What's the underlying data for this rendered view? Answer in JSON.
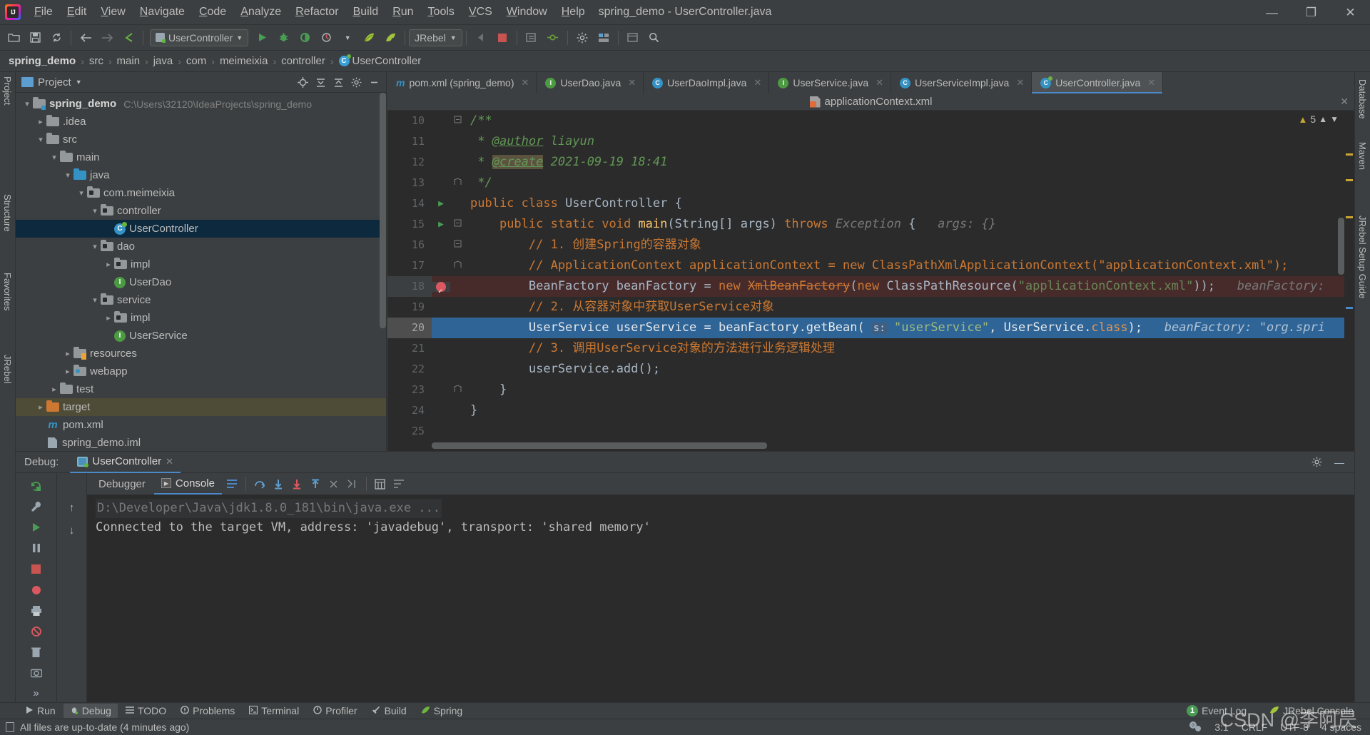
{
  "window": {
    "title": "spring_demo - UserController.java",
    "logo_icon": "intellij-idea-logo",
    "minimize": "—",
    "maximize": "❐",
    "close": "✕"
  },
  "menubar": {
    "items": [
      {
        "label": "File"
      },
      {
        "label": "Edit"
      },
      {
        "label": "View"
      },
      {
        "label": "Navigate"
      },
      {
        "label": "Code"
      },
      {
        "label": "Analyze"
      },
      {
        "label": "Refactor"
      },
      {
        "label": "Build"
      },
      {
        "label": "Run"
      },
      {
        "label": "Tools"
      },
      {
        "label": "VCS"
      },
      {
        "label": "Window"
      },
      {
        "label": "Help"
      }
    ]
  },
  "toolbar": {
    "run_config": "UserController",
    "jrebel_label": "JRebel",
    "icons": [
      "open-folder-icon",
      "save-all-icon",
      "sync-refresh-icon",
      "back-arrow-icon",
      "forward-arrow-icon",
      "pointer-icon",
      "run-icon",
      "debug-icon",
      "coverage-icon",
      "profile-icon",
      "jrebel-run-icon",
      "jrebel-debug-icon",
      "stop-icon",
      "build-icon",
      "hammer-icon",
      "layout-icon",
      "sync-icon",
      "settings-gear-icon",
      "structure-icon",
      "ui-designer-icon",
      "search-icon"
    ]
  },
  "breadcrumb": {
    "items": [
      "spring_demo",
      "src",
      "main",
      "java",
      "com",
      "meimeixia",
      "controller"
    ],
    "current": "UserController",
    "separator": "›"
  },
  "rails": {
    "left_top": "Project",
    "left_items": [
      "Structure",
      "Favorites",
      "JRebel"
    ],
    "right_items": [
      "Database",
      "Maven",
      "JRebel Setup Guide"
    ]
  },
  "project_panel": {
    "title": "Project",
    "header_icons": [
      "locate-icon",
      "collapse-all-icon",
      "expand-all-icon",
      "settings-gear-icon",
      "hide-icon"
    ],
    "tree": [
      {
        "depth": 0,
        "arrow": "open",
        "icon": "module-folder",
        "label": "spring_demo",
        "bold": true,
        "path": "C:\\Users\\32120\\IdeaProjects\\spring_demo",
        "selected": false
      },
      {
        "depth": 1,
        "arrow": "closed",
        "icon": "folder",
        "label": ".idea",
        "bold": false,
        "path": "",
        "selected": false
      },
      {
        "depth": 1,
        "arrow": "open",
        "icon": "folder",
        "label": "src",
        "bold": false,
        "path": "",
        "selected": false
      },
      {
        "depth": 2,
        "arrow": "open",
        "icon": "folder",
        "label": "main",
        "bold": false,
        "path": "",
        "selected": false
      },
      {
        "depth": 3,
        "arrow": "open",
        "icon": "source-folder",
        "label": "java",
        "bold": false,
        "path": "",
        "selected": false
      },
      {
        "depth": 4,
        "arrow": "open",
        "icon": "package",
        "label": "com.meimeixia",
        "bold": false,
        "path": "",
        "selected": false
      },
      {
        "depth": 5,
        "arrow": "open",
        "icon": "package",
        "label": "controller",
        "bold": false,
        "path": "",
        "selected": false
      },
      {
        "depth": 6,
        "arrow": "none",
        "icon": "spring-class",
        "label": "UserController",
        "bold": false,
        "path": "",
        "selected": true
      },
      {
        "depth": 5,
        "arrow": "open",
        "icon": "package",
        "label": "dao",
        "bold": false,
        "path": "",
        "selected": false
      },
      {
        "depth": 6,
        "arrow": "closed",
        "icon": "package",
        "label": "impl",
        "bold": false,
        "path": "",
        "selected": false
      },
      {
        "depth": 6,
        "arrow": "none",
        "icon": "interface",
        "label": "UserDao",
        "bold": false,
        "path": "",
        "selected": false
      },
      {
        "depth": 5,
        "arrow": "open",
        "icon": "package",
        "label": "service",
        "bold": false,
        "path": "",
        "selected": false
      },
      {
        "depth": 6,
        "arrow": "closed",
        "icon": "package",
        "label": "impl",
        "bold": false,
        "path": "",
        "selected": false
      },
      {
        "depth": 6,
        "arrow": "none",
        "icon": "interface",
        "label": "UserService",
        "bold": false,
        "path": "",
        "selected": false
      },
      {
        "depth": 3,
        "arrow": "closed",
        "icon": "resources-folder",
        "label": "resources",
        "bold": false,
        "path": "",
        "selected": false
      },
      {
        "depth": 3,
        "arrow": "closed",
        "icon": "webapp-folder",
        "label": "webapp",
        "bold": false,
        "path": "",
        "selected": false
      },
      {
        "depth": 2,
        "arrow": "closed",
        "icon": "folder",
        "label": "test",
        "bold": false,
        "path": "",
        "selected": false
      },
      {
        "depth": 1,
        "arrow": "closed",
        "icon": "target-folder",
        "label": "target",
        "bold": false,
        "path": "",
        "selected": false,
        "highlight": true
      },
      {
        "depth": 1,
        "arrow": "none",
        "icon": "maven-file",
        "label": "pom.xml",
        "bold": false,
        "path": "",
        "selected": false
      },
      {
        "depth": 1,
        "arrow": "none",
        "icon": "iml-file",
        "label": "spring_demo.iml",
        "bold": false,
        "path": "",
        "selected": false
      }
    ]
  },
  "editor": {
    "tabs": [
      {
        "label": "pom.xml (spring_demo)",
        "icon": "maven-file",
        "active": false
      },
      {
        "label": "UserDao.java",
        "icon": "interface",
        "active": false
      },
      {
        "label": "UserDaoImpl.java",
        "icon": "class",
        "active": false
      },
      {
        "label": "UserService.java",
        "icon": "interface",
        "active": false
      },
      {
        "label": "UserServiceImpl.java",
        "icon": "class",
        "active": false
      },
      {
        "label": "UserController.java",
        "icon": "spring-class",
        "active": true
      }
    ],
    "context_file": "applicationContext.xml",
    "context_icon": "xml-file-icon",
    "inspection": {
      "warning_count": "5",
      "warning_icon": "warning-triangle-icon",
      "up_arrow": "⌃",
      "down_arrow": "⌄"
    },
    "lines": [
      {
        "num": "10",
        "fold": "minus",
        "marker": "",
        "state": "",
        "tokens": [
          {
            "t": "/**",
            "c": "jdoc"
          }
        ],
        "indent": 0
      },
      {
        "num": "11",
        "fold": "",
        "marker": "",
        "state": "",
        "tokens": [
          {
            "t": " * ",
            "c": "jdoc"
          },
          {
            "t": "@author",
            "c": "jtag"
          },
          {
            "t": " liayun",
            "c": "jdoc"
          }
        ],
        "indent": 0
      },
      {
        "num": "12",
        "fold": "",
        "marker": "",
        "state": "",
        "tokens": [
          {
            "t": " * ",
            "c": "jdoc"
          },
          {
            "t": "@create",
            "c": "jtag hi"
          },
          {
            "t": " 2021-09-19 18:41",
            "c": "jdoc"
          }
        ],
        "indent": 0
      },
      {
        "num": "13",
        "fold": "end",
        "marker": "",
        "state": "",
        "tokens": [
          {
            "t": " */",
            "c": "jdoc"
          }
        ],
        "indent": 0
      },
      {
        "num": "14",
        "fold": "",
        "marker": "run",
        "state": "",
        "tokens": [
          {
            "t": "public class ",
            "c": "kw"
          },
          {
            "t": "UserController ",
            "c": "cls"
          },
          {
            "t": "{",
            "c": "plain"
          }
        ],
        "indent": 0
      },
      {
        "num": "15",
        "fold": "minus",
        "marker": "run",
        "state": "",
        "tokens": [
          {
            "t": "    ",
            "c": "plain"
          },
          {
            "t": "public static ",
            "c": "kw"
          },
          {
            "t": "void ",
            "c": "kw"
          },
          {
            "t": "main",
            "c": "mth"
          },
          {
            "t": "(String[] args) ",
            "c": "cls"
          },
          {
            "t": "throws ",
            "c": "kw"
          },
          {
            "t": "Exception ",
            "c": "hint"
          },
          {
            "t": "{   ",
            "c": "plain"
          },
          {
            "t": "args: {}",
            "c": "hint"
          }
        ],
        "indent": 0
      },
      {
        "num": "16",
        "fold": "minus",
        "marker": "",
        "state": "",
        "tokens": [
          {
            "t": "        // 1. 创建Spring的容器对象",
            "c": "cmt-red"
          }
        ],
        "indent": 0
      },
      {
        "num": "17",
        "fold": "end",
        "marker": "",
        "state": "",
        "tokens": [
          {
            "t": "        // ApplicationContext applicationContext = new ClassPathXmlApplicationContext(\"applicationContext.xml\");",
            "c": "cmt-red"
          }
        ],
        "indent": 0
      },
      {
        "num": "18",
        "fold": "",
        "marker": "breakpoint",
        "state": "breakpoint",
        "tokens": [
          {
            "t": "        BeanFactory beanFactory = ",
            "c": "plain"
          },
          {
            "t": "new ",
            "c": "kw"
          },
          {
            "t": "XmlBeanFactory",
            "c": "strike"
          },
          {
            "t": "(",
            "c": "plain"
          },
          {
            "t": "new ",
            "c": "kw"
          },
          {
            "t": "ClassPathResource(",
            "c": "plain"
          },
          {
            "t": "\"applicationContext.xml\"",
            "c": "str"
          },
          {
            "t": "));   ",
            "c": "plain"
          },
          {
            "t": "beanFactory:",
            "c": "hint"
          }
        ],
        "indent": 0
      },
      {
        "num": "19",
        "fold": "",
        "marker": "",
        "state": "",
        "tokens": [
          {
            "t": "        // 2. 从容器对象中获取UserService对象",
            "c": "cmt-red"
          }
        ],
        "indent": 0
      },
      {
        "num": "20",
        "fold": "",
        "marker": "",
        "state": "current",
        "tokens": [
          {
            "t": "        UserService userService = beanFactory.getBean( ",
            "c": "plain"
          },
          {
            "t": "s:",
            "c": "param-hint"
          },
          {
            "t": " ",
            "c": "plain"
          },
          {
            "t": "\"userService\"",
            "c": "str"
          },
          {
            "t": ", UserService.",
            "c": "plain"
          },
          {
            "t": "class",
            "c": "kw"
          },
          {
            "t": ");   ",
            "c": "plain"
          },
          {
            "t": "beanFactory: \"org.spri",
            "c": "hint"
          }
        ],
        "indent": 0
      },
      {
        "num": "21",
        "fold": "",
        "marker": "",
        "state": "",
        "tokens": [
          {
            "t": "        // 3. 调用UserService对象的方法进行业务逻辑处理",
            "c": "cmt-red"
          }
        ],
        "indent": 0
      },
      {
        "num": "22",
        "fold": "",
        "marker": "",
        "state": "",
        "tokens": [
          {
            "t": "        userService.add();",
            "c": "plain"
          }
        ],
        "indent": 0
      },
      {
        "num": "23",
        "fold": "end",
        "marker": "",
        "state": "",
        "tokens": [
          {
            "t": "    }",
            "c": "plain"
          }
        ],
        "indent": 0
      },
      {
        "num": "24",
        "fold": "",
        "marker": "",
        "state": "",
        "tokens": [
          {
            "t": "}",
            "c": "plain"
          }
        ],
        "indent": 0
      },
      {
        "num": "25",
        "fold": "",
        "marker": "",
        "state": "",
        "tokens": [
          {
            "t": "",
            "c": "plain"
          }
        ],
        "indent": 0
      }
    ]
  },
  "debug": {
    "label": "Debug:",
    "session_tab": "UserController",
    "session_icon": "process-icon",
    "close_icon": "✕",
    "settings_icon": "settings-gear-icon",
    "minimize_icon": "—",
    "restore_layout_icon": "restore-layout-icon",
    "rail_icons": [
      "rerun-icon",
      "wrench-icon",
      "resume-icon",
      "pause-icon",
      "stop-icon",
      "view-breakpoints-icon",
      "print-icon",
      "mute-breakpoints-icon",
      "camera-icon",
      "more-icon"
    ],
    "tabs": [
      {
        "label": "Debugger",
        "active": false,
        "icon": ""
      },
      {
        "label": "Console",
        "active": true,
        "icon": "console-icon"
      }
    ],
    "toolbar_icons": [
      "soft-wrap-icon",
      "step-over-icon",
      "step-into-icon",
      "force-step-into-icon",
      "step-out-icon",
      "drop-frame-icon",
      "run-to-cursor-icon",
      "evaluate-icon",
      "settings-list-icon"
    ],
    "nav_icons": [
      "scroll-up-icon",
      "scroll-down-icon"
    ],
    "console_lines": [
      {
        "text": "D:\\Developer\\Java\\jdk1.8.0_181\\bin\\java.exe ...",
        "style": "dim"
      },
      {
        "text": "Connected to the target VM, address: 'javadebug', transport: 'shared memory'",
        "style": "normal"
      }
    ]
  },
  "toolwindow_bar": {
    "items": [
      {
        "label": "Run",
        "icon": "run-icon",
        "active": false
      },
      {
        "label": "Debug",
        "icon": "debug-icon",
        "active": true
      },
      {
        "label": "TODO",
        "icon": "todo-icon",
        "active": false
      },
      {
        "label": "Problems",
        "icon": "problems-icon",
        "active": false
      },
      {
        "label": "Terminal",
        "icon": "terminal-icon",
        "active": false
      },
      {
        "label": "Profiler",
        "icon": "profiler-icon",
        "active": false
      },
      {
        "label": "Build",
        "icon": "build-icon",
        "active": false
      },
      {
        "label": "Spring",
        "icon": "spring-leaf-icon",
        "active": false
      }
    ],
    "right": [
      {
        "label": "Event Log",
        "badge": "1",
        "icon": "event-log-icon"
      },
      {
        "label": "JRebel Console",
        "badge": "",
        "icon": "jrebel-icon"
      }
    ]
  },
  "statusbar": {
    "message": "All files are up-to-date (4 minutes ago)",
    "message_icon": "document-icon",
    "caret_position": "3:1",
    "line_separator": "CRLF",
    "encoding": "UTF-8",
    "indent": "4 spaces",
    "inspection_icon": "inspection-eye-icon"
  },
  "watermark": "CSDN @李阿昃"
}
